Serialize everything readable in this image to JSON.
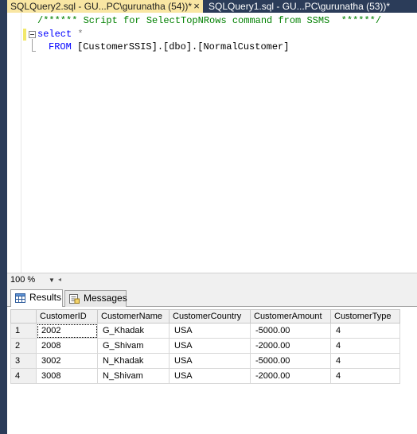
{
  "tabs": [
    {
      "label": "SQLQuery2.sql - GU...PC\\gurunatha (54))*",
      "active": true
    },
    {
      "label": "SQLQuery1.sql - GU...PC\\gurunatha (53))*",
      "active": false
    }
  ],
  "tab_close_glyph": "×",
  "editor": {
    "comment": "/****** Script for SelectTopNRows command from SSMS  ******/",
    "line2_kw": "select",
    "line2_rest": " *",
    "line3_kw": "FROM",
    "line3_rest": " [CustomerSSIS].[dbo].[NormalCustomer]"
  },
  "zoom": {
    "value": "100 %"
  },
  "result_tabs": [
    {
      "label": "Results",
      "icon": "grid-icon"
    },
    {
      "label": "Messages",
      "icon": "messages-icon"
    }
  ],
  "grid": {
    "columns": [
      "CustomerID",
      "CustomerName",
      "CustomerCountry",
      "CustomerAmount",
      "CustomerType"
    ],
    "rows": [
      {
        "num": "1",
        "cells": [
          "2002",
          "G_Khadak",
          "USA",
          "-5000.00",
          "4"
        ]
      },
      {
        "num": "2",
        "cells": [
          "2008",
          "G_Shivam",
          "USA",
          "-2000.00",
          "4"
        ]
      },
      {
        "num": "3",
        "cells": [
          "3002",
          "N_Khadak",
          "USA",
          "-5000.00",
          "4"
        ]
      },
      {
        "num": "4",
        "cells": [
          "3008",
          "N_Shivam",
          "USA",
          "-2000.00",
          "4"
        ]
      }
    ]
  },
  "colors": {
    "active_tab": "#f9e6a3",
    "tab_strip": "#2b3c59",
    "comment": "#008000",
    "keyword": "#0000ff"
  }
}
